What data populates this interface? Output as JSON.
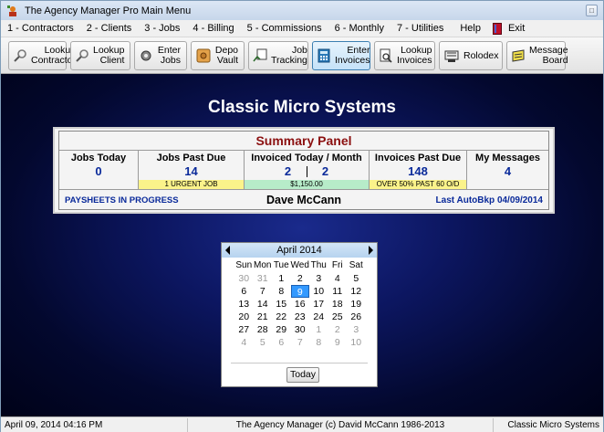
{
  "window": {
    "title": "The Agency Manager Pro Main Menu",
    "minimize_symbol": "□"
  },
  "menu": [
    {
      "key": "1",
      "label": "1 - Contractors"
    },
    {
      "key": "2",
      "label": "2 - Clients"
    },
    {
      "key": "3",
      "label": "3 - Jobs"
    },
    {
      "key": "4",
      "label": "4 - Billing"
    },
    {
      "key": "5",
      "label": "5 - Commissions"
    },
    {
      "key": "6",
      "label": "6 - Monthly"
    },
    {
      "key": "7",
      "label": "7 - Utilities"
    },
    {
      "key": "H",
      "label": "Help"
    },
    {
      "key": "x",
      "label": "Exit"
    }
  ],
  "toolbar": [
    {
      "line1": "Lookup",
      "line2": "Contractor",
      "icon": "magnifier-icon"
    },
    {
      "line1": "Lookup",
      "line2": "Client",
      "icon": "magnifier-icon"
    },
    {
      "line1": "Enter",
      "line2": "Jobs",
      "icon": "gear-icon"
    },
    {
      "line1": "Depo",
      "line2": "Vault",
      "icon": "vault-icon"
    },
    {
      "line1": "Job",
      "line2": "Tracking",
      "icon": "tracking-icon"
    },
    {
      "line1": "Enter",
      "line2": "Invoices",
      "icon": "calculator-icon"
    },
    {
      "line1": "Lookup",
      "line2": "Invoices",
      "icon": "document-search-icon"
    },
    {
      "line1": "Rolodex",
      "line2": "",
      "icon": "rolodex-icon"
    },
    {
      "line1": "Message",
      "line2": "Board",
      "icon": "message-board-icon"
    }
  ],
  "main": {
    "company": "Classic Micro Systems",
    "panel": {
      "title": "Summary Panel",
      "jobs_today": {
        "label": "Jobs Today",
        "value": "0"
      },
      "jobs_past_due": {
        "label": "Jobs Past Due",
        "value": "14",
        "note": "1 URGENT JOB"
      },
      "invoiced": {
        "label": "Invoiced Today / Month",
        "today": "2",
        "month": "2",
        "note": "$1,150.00"
      },
      "invoices_past_due": {
        "label": "Invoices Past Due",
        "value": "148",
        "note": "OVER 50% PAST 60 O/D"
      },
      "messages": {
        "label": "My Messages",
        "value": "4"
      },
      "paysheets": "PAYSHEETS IN PROGRESS",
      "user": "Dave McCann",
      "last_backup": "Last AutoBkp 04/09/2014"
    }
  },
  "calendar": {
    "month": "April 2014",
    "days_of_week": [
      "Sun",
      "Mon",
      "Tue",
      "Wed",
      "Thu",
      "Fri",
      "Sat"
    ],
    "weeks": [
      [
        {
          "d": "30",
          "o": true
        },
        {
          "d": "31",
          "o": true
        },
        {
          "d": "1"
        },
        {
          "d": "2"
        },
        {
          "d": "3"
        },
        {
          "d": "4"
        },
        {
          "d": "5"
        }
      ],
      [
        {
          "d": "6"
        },
        {
          "d": "7"
        },
        {
          "d": "8"
        },
        {
          "d": "9",
          "sel": true
        },
        {
          "d": "10"
        },
        {
          "d": "11"
        },
        {
          "d": "12"
        }
      ],
      [
        {
          "d": "13"
        },
        {
          "d": "14"
        },
        {
          "d": "15"
        },
        {
          "d": "16"
        },
        {
          "d": "17"
        },
        {
          "d": "18"
        },
        {
          "d": "19"
        }
      ],
      [
        {
          "d": "20"
        },
        {
          "d": "21"
        },
        {
          "d": "22"
        },
        {
          "d": "23"
        },
        {
          "d": "24"
        },
        {
          "d": "25"
        },
        {
          "d": "26"
        }
      ],
      [
        {
          "d": "27"
        },
        {
          "d": "28"
        },
        {
          "d": "29"
        },
        {
          "d": "30"
        },
        {
          "d": "1",
          "o": true
        },
        {
          "d": "2",
          "o": true
        },
        {
          "d": "3",
          "o": true
        }
      ],
      [
        {
          "d": "4",
          "o": true
        },
        {
          "d": "5",
          "o": true
        },
        {
          "d": "6",
          "o": true
        },
        {
          "d": "7",
          "o": true
        },
        {
          "d": "8",
          "o": true
        },
        {
          "d": "9",
          "o": true
        },
        {
          "d": "10",
          "o": true
        }
      ]
    ],
    "today_label": "Today"
  },
  "status": {
    "datetime": "April 09, 2014 04:16  PM",
    "copyright": "The Agency Manager (c) David McCann 1986-2013",
    "company": "Classic Micro Systems"
  },
  "colors": {
    "accent_blue": "#0a2a9a",
    "title_red": "#8b1010",
    "selected_day": "#3399ff"
  }
}
